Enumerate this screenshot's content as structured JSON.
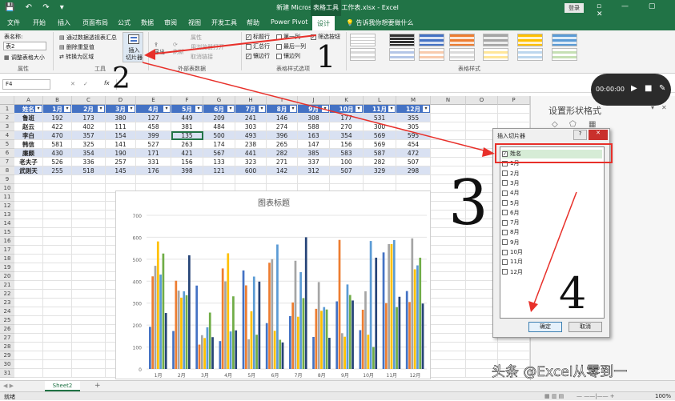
{
  "titlebar": {
    "title": "新建 Microsoft Excel 工作表.xlsx  -  Excel",
    "context_tool": "表格工具",
    "login": "登录",
    "quick_access": "💾 ↶ ↷ ▾",
    "window_controls": "▫ — ▢ ✕"
  },
  "tabs": [
    "文件",
    "开始",
    "插入",
    "页面布局",
    "公式",
    "数据",
    "审阅",
    "视图",
    "开发工具",
    "帮助",
    "Power Pivot",
    "设计",
    "💡 告诉我你想要做什么"
  ],
  "ribbon": {
    "table_name_label": "表名称:",
    "table_name_value": "表2",
    "resize_table": "调整表格大小",
    "properties_group": "属性",
    "summarize_pivot": "通过数据透视表汇总",
    "remove_duplicates": "删除重复值",
    "convert_range": "转换为区域",
    "tools_group": "工具",
    "insert_slicer": "插入\n切片器",
    "export": "导出",
    "refresh": "刷新",
    "properties_btn": "属性",
    "open_browser": "用浏览器打开",
    "unlink": "取消链接",
    "external_group": "外部表数据",
    "opt_header_row": "标题行",
    "opt_total_row": "汇总行",
    "opt_banded_rows": "镶边行",
    "opt_first_col": "第一列",
    "opt_last_col": "最后一列",
    "opt_banded_cols": "镶边列",
    "opt_filter_btn": "筛选按钮",
    "options_group": "表格样式选项",
    "styles_group": "表格样式"
  },
  "formula_bar": {
    "namebox": "F4",
    "fx": "fx",
    "value": ""
  },
  "columns": [
    "A",
    "B",
    "C",
    "D",
    "E",
    "F",
    "G",
    "H",
    "I",
    "J",
    "K",
    "L",
    "M",
    "N",
    "O",
    "P"
  ],
  "table": {
    "header": [
      "姓名",
      "1月",
      "2月",
      "3月",
      "4月",
      "5月",
      "6月",
      "7月",
      "8月",
      "9月",
      "10月",
      "11月",
      "12月"
    ],
    "rows": [
      [
        "鲁班",
        "192",
        "173",
        "380",
        "127",
        "449",
        "209",
        "241",
        "146",
        "308",
        "177",
        "531",
        "355"
      ],
      [
        "赵云",
        "422",
        "402",
        "111",
        "458",
        "381",
        "484",
        "303",
        "274",
        "588",
        "270",
        "300",
        "305"
      ],
      [
        "李白",
        "470",
        "357",
        "154",
        "399",
        "135",
        "500",
        "493",
        "396",
        "163",
        "354",
        "569",
        "595"
      ],
      [
        "韩信",
        "581",
        "325",
        "141",
        "527",
        "263",
        "174",
        "238",
        "265",
        "147",
        "156",
        "569",
        "454"
      ],
      [
        "廉颇",
        "430",
        "354",
        "190",
        "171",
        "421",
        "567",
        "441",
        "282",
        "385",
        "583",
        "587",
        "472"
      ],
      [
        "老夫子",
        "526",
        "336",
        "257",
        "331",
        "156",
        "133",
        "323",
        "271",
        "337",
        "100",
        "282",
        "507"
      ],
      [
        "武则天",
        "255",
        "518",
        "145",
        "176",
        "398",
        "121",
        "600",
        "142",
        "312",
        "507",
        "329",
        "298"
      ]
    ]
  },
  "chart_data": {
    "type": "bar",
    "title": "图表标题",
    "categories": [
      "1月",
      "2月",
      "3月",
      "4月",
      "5月",
      "6月",
      "7月",
      "8月",
      "9月",
      "10月",
      "11月",
      "12月"
    ],
    "series": [
      {
        "values": [
          192,
          173,
          380,
          127,
          449,
          209,
          241,
          146,
          308,
          177,
          531,
          355
        ]
      },
      {
        "values": [
          422,
          402,
          111,
          458,
          381,
          484,
          303,
          274,
          588,
          270,
          300,
          305
        ]
      },
      {
        "values": [
          470,
          357,
          154,
          399,
          135,
          500,
          493,
          396,
          163,
          354,
          569,
          595
        ]
      },
      {
        "values": [
          581,
          325,
          141,
          527,
          263,
          174,
          238,
          265,
          147,
          156,
          569,
          454
        ]
      },
      {
        "values": [
          430,
          354,
          190,
          171,
          421,
          567,
          441,
          282,
          385,
          583,
          587,
          472
        ]
      },
      {
        "values": [
          526,
          336,
          257,
          331,
          156,
          133,
          323,
          271,
          337,
          100,
          282,
          507
        ]
      },
      {
        "values": [
          255,
          518,
          145,
          176,
          398,
          121,
          600,
          142,
          312,
          507,
          329,
          298
        ]
      }
    ],
    "colors": [
      "#4472c4",
      "#ed7d31",
      "#a5a5a5",
      "#ffc000",
      "#5b9bd5",
      "#70ad47",
      "#264478"
    ],
    "yticks": [
      "0",
      "100",
      "200",
      "300",
      "400",
      "500",
      "600",
      "700"
    ],
    "ylim": [
      0,
      700
    ],
    "grid": true
  },
  "dialog": {
    "title": "插入切片器",
    "help": "?",
    "close": "✕",
    "fields": [
      "姓名",
      "1月",
      "2月",
      "3月",
      "4月",
      "5月",
      "6月",
      "7月",
      "8月",
      "9月",
      "10月",
      "11月",
      "12月"
    ],
    "checked": [
      true,
      false,
      false,
      false,
      false,
      false,
      false,
      false,
      false,
      false,
      false,
      false,
      false
    ],
    "ok": "确定",
    "cancel": "取消"
  },
  "panel": {
    "title": "设置形状格式",
    "close": "✕",
    "pin": "▾"
  },
  "sheet_tab": "Sheet2",
  "add_sheet": "+",
  "status": {
    "ready": "就绪",
    "zoom": "100%"
  },
  "timer": {
    "time": "00:00:00",
    "play": "▶",
    "stop": "■",
    "edit": "✎"
  },
  "annotations": {
    "n1": "1",
    "n2": "2",
    "n3": "3",
    "n4": "4"
  },
  "watermark": "头条 @Excel从零到一"
}
